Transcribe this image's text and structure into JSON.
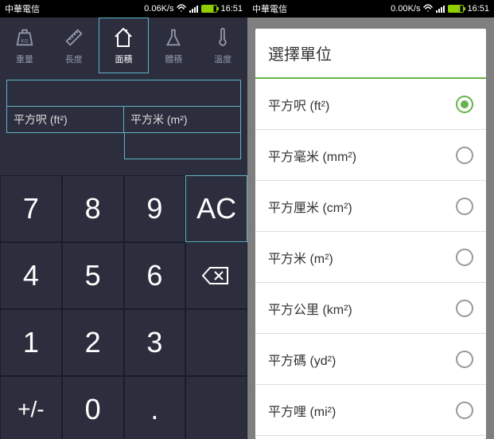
{
  "status": {
    "carrier": "中華電信",
    "speed_left": "0.06K/s",
    "speed_right": "0.00K/s",
    "time": "16:51"
  },
  "tabs": [
    {
      "label": "重量",
      "icon": "weight"
    },
    {
      "label": "長度",
      "icon": "ruler"
    },
    {
      "label": "面積",
      "icon": "house"
    },
    {
      "label": "體積",
      "icon": "flask"
    },
    {
      "label": "溫度",
      "icon": "thermometer"
    }
  ],
  "active_tab": 2,
  "units": {
    "from": "平方呎 (ft²)",
    "to": "平方米 (m²)"
  },
  "keypad": {
    "r1": [
      "7",
      "8",
      "9",
      "AC"
    ],
    "r2": [
      "4",
      "5",
      "6",
      ""
    ],
    "r3": [
      "1",
      "2",
      "3",
      ""
    ],
    "r4": [
      "+/-",
      "0",
      ".",
      ""
    ]
  },
  "dialog": {
    "title": "選擇單位",
    "options": [
      {
        "label": "平方呎 (ft²)",
        "selected": true
      },
      {
        "label": "平方毫米 (mm²)",
        "selected": false
      },
      {
        "label": "平方厘米 (cm²)",
        "selected": false
      },
      {
        "label": "平方米 (m²)",
        "selected": false
      },
      {
        "label": "平方公里 (km²)",
        "selected": false
      },
      {
        "label": "平方碼 (yd²)",
        "selected": false
      },
      {
        "label": "平方哩 (mi²)",
        "selected": false
      }
    ]
  }
}
